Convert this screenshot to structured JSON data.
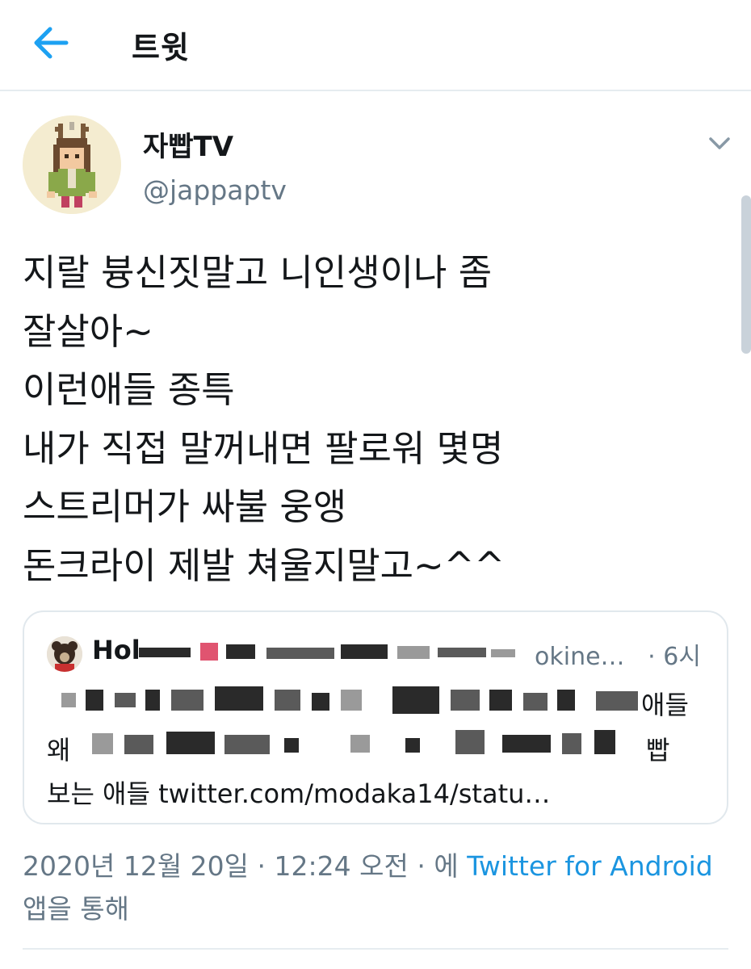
{
  "header": {
    "title": "트윗",
    "back_icon": "arrow-left-icon",
    "accent_color": "#1da1f2"
  },
  "author": {
    "display_name": "자빱TV",
    "handle": "@jappaptv"
  },
  "tweet": {
    "lines": [
      "지랄 븅신짓말고 니인생이나 좀",
      "잘살아~",
      "이런애들 종특",
      "내가 직접 말꺼내면 팔로워 몇명",
      "스트리머가 싸불 웅앵",
      "돈크라이 제발 쳐울지말고~^^"
    ]
  },
  "quoted_tweet": {
    "name_visible": "Hol",
    "handle_visible": "okine…",
    "time": "· 6시",
    "line1_end": "애들",
    "line2_start": "왜",
    "line2_end": "빱",
    "line3": "보는 애들 twitter.com/modaka14/statu…"
  },
  "timestamp": {
    "date": "2020년 12월 20일",
    "time": "12:24 오전",
    "via_prefix": "에",
    "client": "Twitter for Android",
    "via_suffix": "앱을 통해"
  }
}
